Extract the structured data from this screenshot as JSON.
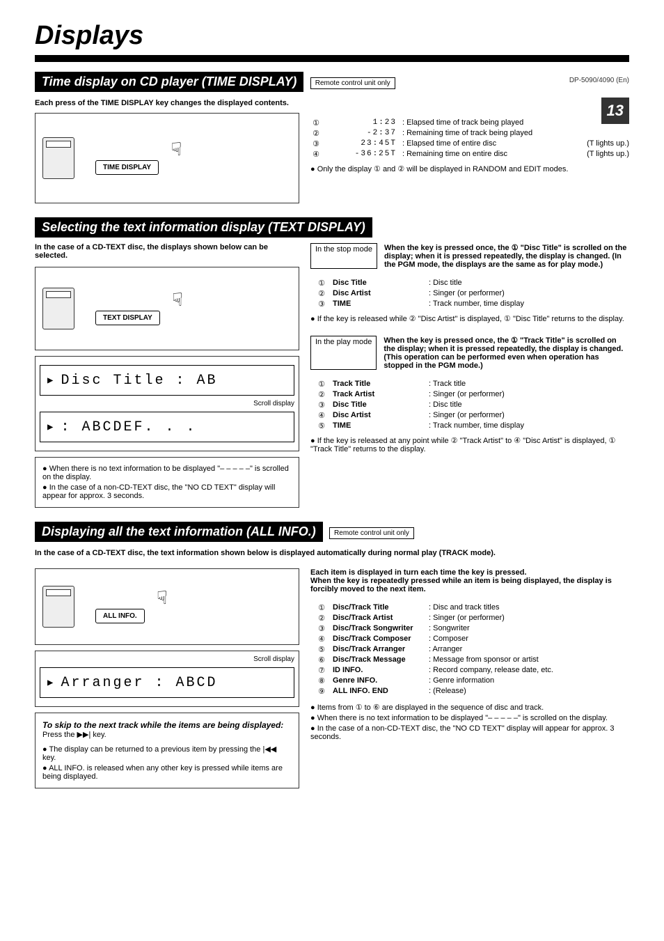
{
  "page": {
    "mainTitle": "Displays",
    "model": "DP-5090/4090 (En)",
    "pageNum": "13"
  },
  "sec1": {
    "heading": "Time display on CD player (TIME DISPLAY)",
    "remoteOnly": "Remote control unit only",
    "intro": "Each press of the TIME DISPLAY key changes the displayed contents.",
    "btn": "TIME DISPLAY",
    "lines": [
      {
        "n": "①",
        "t": "1:23",
        "d": ": Elapsed time of track being played",
        "extra": ""
      },
      {
        "n": "②",
        "t": "-2:37",
        "d": ": Remaining time of track being played",
        "extra": ""
      },
      {
        "n": "③",
        "t": "23:45T",
        "d": ": Elapsed time of entire disc",
        "extra": "(T lights up.)"
      },
      {
        "n": "④",
        "t": "-36:25T",
        "d": ": Remaining time on entire disc",
        "extra": "(T lights up.)"
      }
    ],
    "note": "Only the display ① and ② will be displayed in RANDOM and EDIT modes."
  },
  "sec2": {
    "heading": "Selecting the text information display (TEXT DISPLAY)",
    "intro": "In the case of a CD-TEXT disc, the displays shown below can be selected.",
    "btn": "TEXT DISPLAY",
    "lcd1": "Disc Title  :  AB",
    "lcd1label": "Scroll display",
    "lcd2": ":   ABCDEF. . .",
    "notes": [
      "When there is no text information to be displayed \"– – – – –\" is scrolled on the display.",
      "In the case of a non-CD-TEXT disc, the \"NO CD TEXT\" display will appear for approx. 3 seconds."
    ],
    "stopBox": "In the stop mode",
    "stopText": "When the key is pressed once, the ① \"Disc Title\" is scrolled on the display; when it is pressed repeatedly, the display is changed. (In the PGM mode, the displays are the same as for play mode.)",
    "stopList": [
      {
        "n": "①",
        "l": "Disc Title",
        "d": ": Disc title"
      },
      {
        "n": "②",
        "l": "Disc Artist",
        "d": ": Singer (or performer)"
      },
      {
        "n": "③",
        "l": "TIME",
        "d": ": Track number, time display"
      }
    ],
    "stopNote": "If the key is released while ② \"Disc Artist\" is displayed, ① \"Disc Title\" returns to the display.",
    "playBox": "In the play mode",
    "playText": "When the key is pressed once, the ① \"Track Title\" is scrolled on the display; when it is pressed repeatedly, the display is changed. (This operation can be performed even when operation has stopped in the PGM mode.)",
    "playList": [
      {
        "n": "①",
        "l": "Track Title",
        "d": ": Track title"
      },
      {
        "n": "②",
        "l": "Track Artist",
        "d": ": Singer (or performer)"
      },
      {
        "n": "③",
        "l": "Disc Title",
        "d": ": Disc title"
      },
      {
        "n": "④",
        "l": "Disc Artist",
        "d": ": Singer (or performer)"
      },
      {
        "n": "⑤",
        "l": "TIME",
        "d": ": Track number, time display"
      }
    ],
    "playNote": "If the key is released at any point while ② \"Track Artist\" to ④ \"Disc Artist\" is displayed, ① \"Track Title\" returns to the display."
  },
  "sec3": {
    "heading": "Displaying all the text information (ALL INFO.)",
    "remoteOnly": "Remote control unit only",
    "intro": "In the case of a CD-TEXT disc, the text information shown below is displayed automatically during normal play (TRACK mode).",
    "btn": "ALL INFO.",
    "lcdLabel": "Scroll display",
    "lcd": "Arranger   :  ABCD",
    "tipTitle": "To skip to the next track while the items are being displayed:",
    "tip": "Press the ▶▶| key.",
    "notes": [
      "The display can be returned to a previous item by pressing the |◀◀ key.",
      "ALL INFO. is released when any other key is pressed while items are being displayed."
    ],
    "rIntro1": "Each item is displayed in turn each time the key is pressed.",
    "rIntro2": "When the key is repeatedly pressed while an item is being displayed, the display is forcibly moved to the next item.",
    "list": [
      {
        "n": "①",
        "l": "Disc/Track Title",
        "d": ": Disc and track titles"
      },
      {
        "n": "②",
        "l": "Disc/Track Artist",
        "d": ": Singer (or performer)"
      },
      {
        "n": "③",
        "l": "Disc/Track Songwriter",
        "d": ": Songwriter"
      },
      {
        "n": "④",
        "l": "Disc/Track Composer",
        "d": ": Composer"
      },
      {
        "n": "⑤",
        "l": "Disc/Track Arranger",
        "d": ": Arranger"
      },
      {
        "n": "⑥",
        "l": "Disc/Track Message",
        "d": ": Message from sponsor or artist"
      },
      {
        "n": "⑦",
        "l": "ID INFO.",
        "d": ": Record company, release date, etc."
      },
      {
        "n": "⑧",
        "l": "Genre INFO.",
        "d": ": Genre information"
      },
      {
        "n": "⑨",
        "l": "ALL INFO. END",
        "d": ": (Release)"
      }
    ],
    "rnotes": [
      "Items from ① to ⑥ are displayed in the sequence of disc and track.",
      "When there is no text information to be displayed \"– – – – –\" is scrolled on the display.",
      "In the case of a non-CD-TEXT disc, the \"NO CD TEXT\" display will appear for approx. 3 seconds."
    ]
  }
}
